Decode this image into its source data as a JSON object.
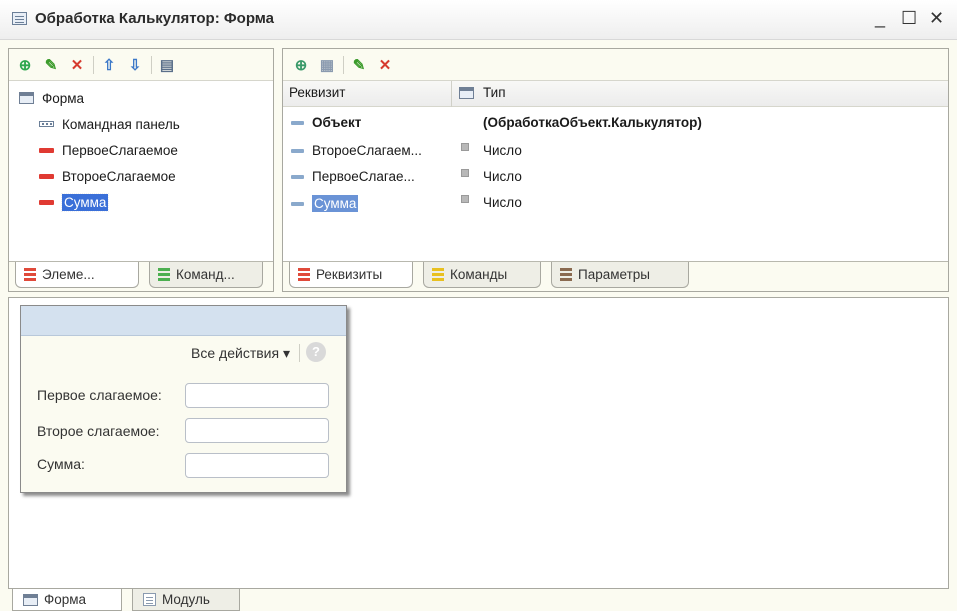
{
  "window": {
    "title": "Обработка Калькулятор: Форма",
    "controls": {
      "minimize": "_",
      "maximize": "☐",
      "close": "✕"
    }
  },
  "elements_panel": {
    "toolbar": [
      {
        "name": "add-icon",
        "glyph": "⊕",
        "color": "#2fa84f"
      },
      {
        "name": "edit-icon",
        "glyph": "✎",
        "color": "#3a9a2a"
      },
      {
        "name": "delete-icon",
        "glyph": "✕",
        "color": "#d63a2e"
      },
      {
        "name": "move-up-icon",
        "glyph": "⇧",
        "color": "#3c78c8"
      },
      {
        "name": "move-down-icon",
        "glyph": "⇩",
        "color": "#3c78c8"
      },
      {
        "name": "properties-icon",
        "glyph": "▤",
        "color": "#5a6f8a"
      }
    ],
    "tree": [
      {
        "label": "Форма",
        "icon": "form-icon"
      },
      {
        "label": "Командная панель",
        "icon": "command-bar-icon"
      },
      {
        "label": "ПервоеСлагаемое",
        "icon": "field-icon"
      },
      {
        "label": "ВтороеСлагаемое",
        "icon": "field-icon"
      },
      {
        "label": "Сумма",
        "icon": "field-icon",
        "selected": true
      }
    ],
    "tabs": [
      "Элеме...",
      "Команд..."
    ]
  },
  "attributes_panel": {
    "toolbar": [
      {
        "name": "add-attribute-icon",
        "glyph": "⊕",
        "color": "#3a9a6a"
      },
      {
        "name": "table-icon",
        "glyph": "▦",
        "color": "#8a9aaf"
      },
      {
        "name": "edit-icon",
        "glyph": "✎",
        "color": "#3a9a2a"
      },
      {
        "name": "delete-icon",
        "glyph": "✕",
        "color": "#d63a2e"
      }
    ],
    "columns": [
      "Реквизит",
      "Тип"
    ],
    "rows": [
      {
        "name": "Объект",
        "type": "(ОбработкаОбъект.Калькулятор)",
        "bold": true
      },
      {
        "name": "ВтороеСлагаем...",
        "type": "Число"
      },
      {
        "name": "ПервоеСлагае...",
        "type": "Число"
      },
      {
        "name": "Сумма",
        "type": "Число",
        "selected": true
      }
    ],
    "tabs": [
      "Реквизиты",
      "Команды",
      "Параметры"
    ]
  },
  "form_preview": {
    "all_actions": "Все действия",
    "help": "?",
    "fields": [
      {
        "label": "Первое слагаемое:",
        "value": ""
      },
      {
        "label": "Второе слагаемое:",
        "value": ""
      },
      {
        "label": "Сумма:",
        "value": ""
      }
    ]
  },
  "bottom_tabs": [
    "Форма",
    "Модуль"
  ],
  "colors": {
    "selection": "#3a6fd8",
    "tab_stack_red": "#e04a3a",
    "tab_stack_green": "#4caf50",
    "tab_stack_yellow": "#e8c020",
    "tab_stack_brown": "#8a6a50"
  }
}
